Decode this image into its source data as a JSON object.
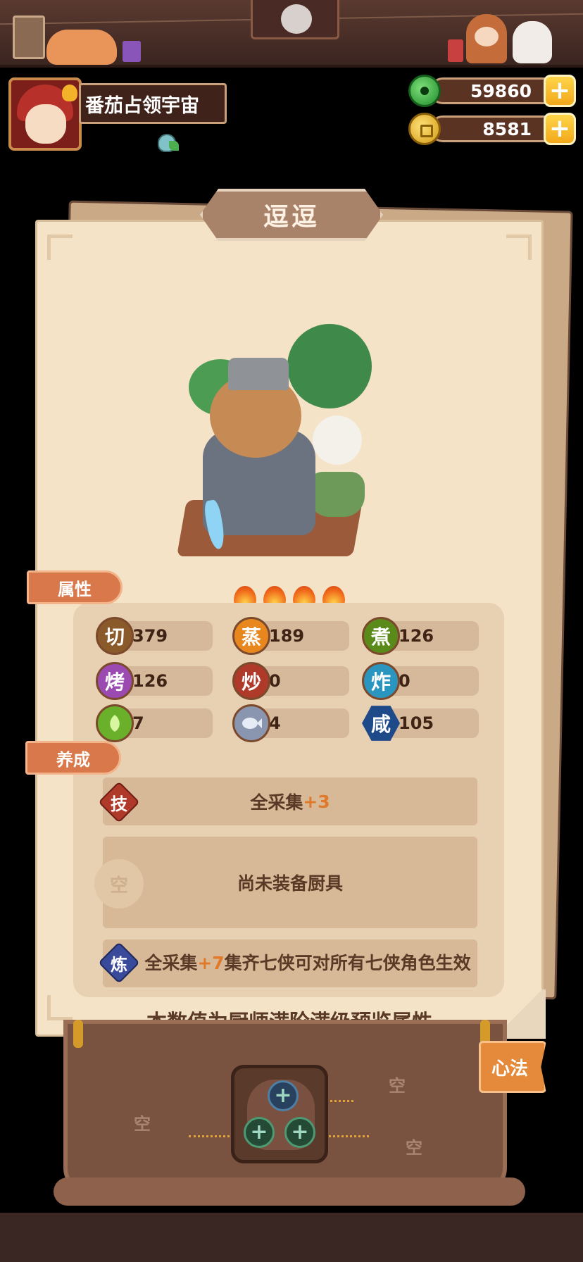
{
  "player": {
    "name": "番茄占领宇宙",
    "avatar_icon": "player-avatar-icon",
    "title_icon": "shell-badge-icon"
  },
  "currencies": [
    {
      "name": "jade",
      "icon": "jade-icon",
      "value": "59860",
      "plus": "+"
    },
    {
      "name": "coin",
      "icon": "coin-icon",
      "value": "8581",
      "plus": "+"
    }
  ],
  "chef": {
    "name": "逗逗",
    "stars": 4
  },
  "sections": {
    "attributes": "属性",
    "cultivation": "养成"
  },
  "stats": [
    {
      "key": "qie",
      "label": "切",
      "value": "379",
      "color": "#8a5a2a"
    },
    {
      "key": "zheng",
      "label": "蒸",
      "value": "189",
      "color": "#e8871e"
    },
    {
      "key": "zhu",
      "label": "煮",
      "value": "126",
      "color": "#5a8a1a"
    },
    {
      "key": "kao",
      "label": "烤",
      "value": "126",
      "color": "#9a4ab0"
    },
    {
      "key": "chao",
      "label": "炒",
      "value": "0",
      "color": "#b03a2a"
    },
    {
      "key": "zha",
      "label": "炸",
      "value": "0",
      "color": "#2a96c0"
    },
    {
      "key": "veg",
      "label": "",
      "value": "7",
      "color": "#6ab02a",
      "icon": "vegetable-icon"
    },
    {
      "key": "fish",
      "label": "",
      "value": "4",
      "color": "#8a96b0",
      "icon": "fish-icon"
    },
    {
      "key": "xian",
      "label": "咸",
      "value": "105",
      "color": "#1e4a8a"
    }
  ],
  "skill": {
    "badge": "技",
    "text_prefix": "全采集",
    "text_highlight": "+3"
  },
  "equipment": {
    "badge": "空",
    "text": "尚未装备厨具"
  },
  "refine": {
    "badge": "炼",
    "text_prefix": "全采集",
    "text_highlight": "+7",
    "text_rest": "集齐七侠可对所有七侠角色生效"
  },
  "footer_note": "本数值为厨师满阶满级预览属性",
  "bottom": {
    "xinfa_button": "心法",
    "empty_slot": "空",
    "socket_symbol": "+"
  }
}
